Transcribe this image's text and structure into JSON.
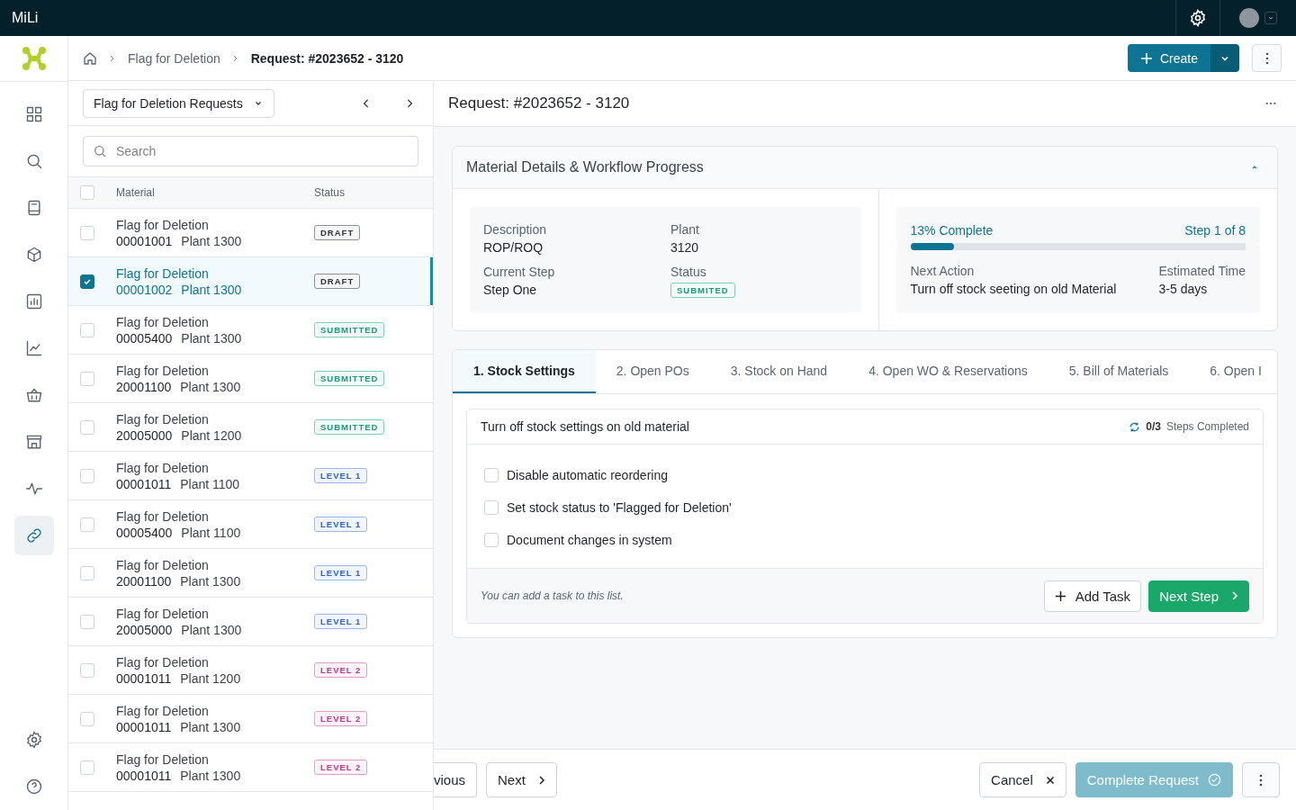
{
  "app": {
    "title": "MiLi"
  },
  "breadcrumb": [
    {
      "label": "Flag for Deletion",
      "current": false
    },
    {
      "label": "Request: #2023652 - 3120",
      "current": true
    }
  ],
  "create_button": "Create",
  "nav": [
    {
      "selected": false
    },
    {
      "selected": false
    },
    {
      "selected": false
    },
    {
      "selected": false
    },
    {
      "selected": false
    },
    {
      "selected": false
    },
    {
      "selected": false
    },
    {
      "selected": false
    },
    {
      "selected": false
    },
    {
      "selected": true
    }
  ],
  "list": {
    "view": "Flag for Deletion Requests",
    "search_placeholder": "Search",
    "columns": [
      "Material",
      "Status"
    ],
    "select_all_checked": false,
    "rows": [
      {
        "title": "Flag for Deletion",
        "number": "00001001",
        "plant": "Plant 1300",
        "status": "DRAFT",
        "kind": "draft",
        "checked": false,
        "selected": false
      },
      {
        "title": "Flag for Deletion",
        "number": "00001002",
        "plant": "Plant 1300",
        "status": "DRAFT",
        "kind": "draft",
        "checked": true,
        "selected": true
      },
      {
        "title": "Flag for Deletion",
        "number": "00005400",
        "plant": "Plant 1300",
        "status": "SUBMITTED",
        "kind": "submitted",
        "checked": false,
        "selected": false
      },
      {
        "title": "Flag for Deletion",
        "number": "20001100",
        "plant": "Plant 1300",
        "status": "SUBMITTED",
        "kind": "submitted",
        "checked": false,
        "selected": false
      },
      {
        "title": "Flag for Deletion",
        "number": "20005000",
        "plant": "Plant 1200",
        "status": "SUBMITTED",
        "kind": "submitted",
        "checked": false,
        "selected": false
      },
      {
        "title": "Flag for Deletion",
        "number": "00001011",
        "plant": "Plant 1100",
        "status": "LEVEL 1",
        "kind": "level1",
        "checked": false,
        "selected": false
      },
      {
        "title": "Flag for Deletion",
        "number": "00005400",
        "plant": "Plant 1100",
        "status": "LEVEL 1",
        "kind": "level1",
        "checked": false,
        "selected": false
      },
      {
        "title": "Flag for Deletion",
        "number": "20001100",
        "plant": "Plant 1300",
        "status": "LEVEL 1",
        "kind": "level1",
        "checked": false,
        "selected": false
      },
      {
        "title": "Flag for Deletion",
        "number": "20005000",
        "plant": "Plant 1300",
        "status": "LEVEL 1",
        "kind": "level1",
        "checked": false,
        "selected": false
      },
      {
        "title": "Flag for Deletion",
        "number": "00001011",
        "plant": "Plant 1200",
        "status": "LEVEL 2",
        "kind": "level2",
        "checked": false,
        "selected": false
      },
      {
        "title": "Flag for Deletion",
        "number": "00001011",
        "plant": "Plant 1300",
        "status": "LEVEL 2",
        "kind": "level2",
        "checked": false,
        "selected": false
      },
      {
        "title": "Flag for Deletion",
        "number": "00001011",
        "plant": "Plant 1300",
        "status": "LEVEL 2",
        "kind": "level2",
        "checked": false,
        "selected": false
      }
    ]
  },
  "detail": {
    "title": "Request: #2023652 - 3120",
    "card_title": "Material Details & Workflow Progress",
    "expanded": true,
    "fields": [
      {
        "label": "Description",
        "value": "ROP/ROQ",
        "kind": "text"
      },
      {
        "label": "Plant",
        "value": "3120",
        "kind": "text"
      },
      {
        "label": "Current Step",
        "value": "Step One",
        "kind": "text"
      },
      {
        "label": "Status",
        "value": "SUBMITED",
        "kind": "badge"
      }
    ],
    "progress": {
      "complete": "13% Complete",
      "step": "Step 1 of 8",
      "level": 0.13,
      "next_action_label": "Next Action",
      "next_action": "Turn off stock seeting on old Material",
      "time_label": "Estimated Time",
      "time": "3-5 days"
    }
  },
  "tabs": [
    {
      "label": "1. Stock Settings",
      "selected": true
    },
    {
      "label": "2. Open POs",
      "selected": false
    },
    {
      "label": "3. Stock on Hand",
      "selected": false
    },
    {
      "label": "4. Open WO & Reservations",
      "selected": false
    },
    {
      "label": "5. Bill of Materials",
      "selected": false
    },
    {
      "label": "6. Open I",
      "selected": false
    }
  ],
  "task_panel": {
    "title": "Turn off stock settings on old material",
    "count": "0/3",
    "count_label": "Steps Completed",
    "tasks": [
      {
        "label": "Disable automatic reordering",
        "checked": false
      },
      {
        "label": "Set stock status to 'Flagged for Deletion'",
        "checked": false
      },
      {
        "label": "Document changes in system",
        "checked": false
      }
    ],
    "hint": "You can add a task to this list.",
    "add_task": "Add Task",
    "next_step": "Next Step"
  },
  "footer": {
    "previous": "vious",
    "next": "Next",
    "cancel": "Cancel",
    "complete": "Complete Request"
  }
}
